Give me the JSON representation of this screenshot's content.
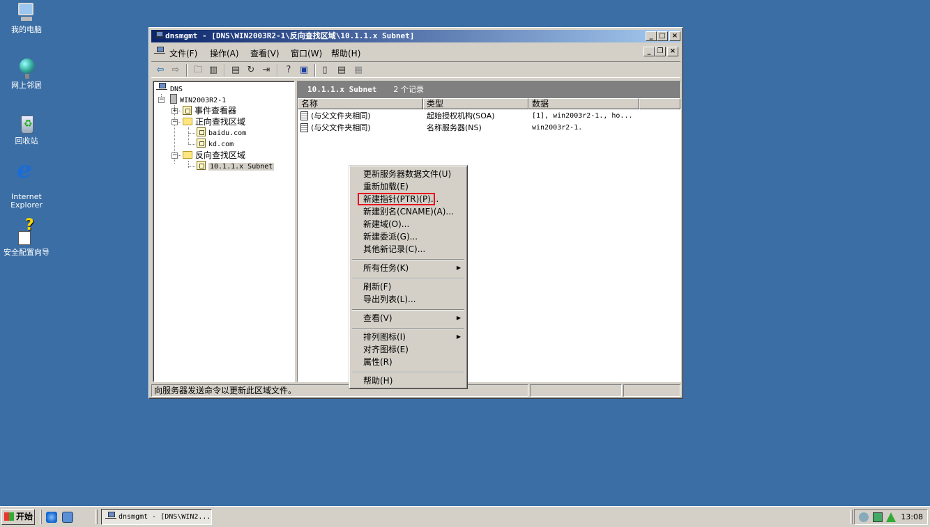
{
  "desktop": {
    "icons": [
      {
        "label": "我的电脑"
      },
      {
        "label": "网上邻居"
      },
      {
        "label": "回收站"
      },
      {
        "label": "Internet Explorer"
      },
      {
        "label": "安全配置向导"
      }
    ]
  },
  "window": {
    "title": "dnsmgmt - [DNS\\WIN2003R2-1\\反向查找区域\\10.1.1.x Subnet]",
    "controls": {
      "minimize": "_",
      "maximize": "□",
      "close": "×"
    },
    "menu": {
      "items": [
        "文件(F)",
        "操作(A)",
        "查看(V)",
        "窗口(W)",
        "帮助(H)"
      ]
    },
    "toolbar": {
      "buttons": [
        "back-icon",
        "forward-icon",
        "up-icon",
        "show-hide-tree-icon",
        "properties-icon",
        "refresh-icon",
        "export-icon",
        "help-icon",
        "mmc-icon",
        "update-icon",
        "new-record-icon",
        "delete-icon"
      ]
    },
    "tree": {
      "root": "DNS",
      "server": "WIN2003R2-1",
      "event_viewer": "事件查看器",
      "forward_zones": "正向查找区域",
      "forward_children": [
        "baidu.com",
        "kd.com"
      ],
      "reverse_zones": "反向查找区域",
      "reverse_children": [
        "10.1.1.x Subnet"
      ]
    },
    "list": {
      "header_title": "10.1.1.x Subnet",
      "header_count": "2 个记录",
      "columns": [
        "名称",
        "类型",
        "数据",
        ""
      ],
      "rows": [
        {
          "name": "(与父文件夹相同)",
          "type": "起始授权机构(SOA)",
          "data": "[1], win2003r2-1., ho..."
        },
        {
          "name": "(与父文件夹相同)",
          "type": "名称服务器(NS)",
          "data": "win2003r2-1."
        }
      ]
    },
    "status": {
      "text": "向服务器发送命令以更新此区域文件。",
      "cell2": "",
      "cell3": ""
    }
  },
  "context_menu": {
    "items": [
      {
        "label": "更新服务器数据文件(U)"
      },
      {
        "label": "重新加载(E)"
      },
      {
        "label": "新建指针(PTR)(P)..."
      },
      {
        "label": "新建别名(CNAME)(A)..."
      },
      {
        "label": "新建域(O)..."
      },
      {
        "label": "新建委派(G)..."
      },
      {
        "label": "其他新记录(C)..."
      },
      {
        "label": "所有任务(K)"
      },
      {
        "label": "刷新(F)"
      },
      {
        "label": "导出列表(L)..."
      },
      {
        "label": "查看(V)"
      },
      {
        "label": "排列图标(I)"
      },
      {
        "label": "对齐图标(E)"
      },
      {
        "label": "属性(R)"
      },
      {
        "label": "帮助(H)"
      }
    ],
    "highlight_color": "#e8101e"
  },
  "taskbar": {
    "start_label": "开始",
    "task_label": "dnsmgmt - [DNS\\WIN2...",
    "clock": "13:08"
  }
}
